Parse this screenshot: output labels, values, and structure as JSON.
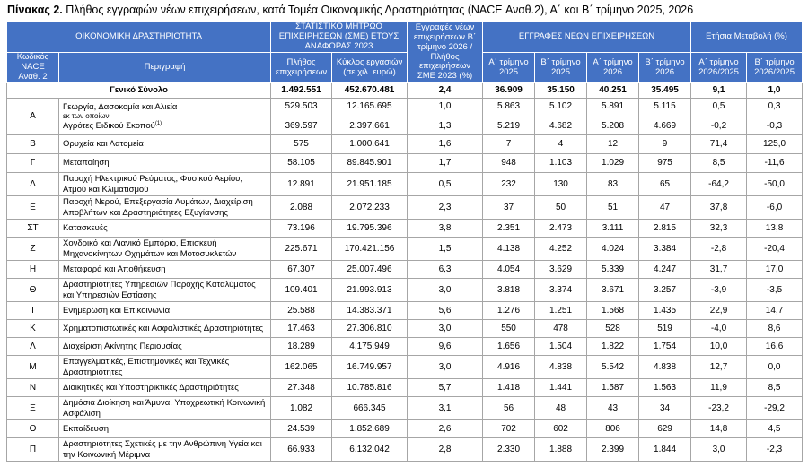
{
  "title_bold": "Πίνακας 2.",
  "title_text": " Πλήθος εγγραφών νέων επιχειρήσεων, κατά Τομέα Οικονομικής Δραστηριότητας (NACE Αναθ.2), Α΄ και Β΄ τρίμηνο 2025, 2026",
  "header": {
    "econ_activity": "ΟΙΚΟΝΟΜΙΚΗ ΔΡΑΣΤΗΡΙΟΤΗΤΑ",
    "sme_register": "ΣΤΑΤΙΣΤΙΚΟ ΜΗΤΡΩΟ ΕΠΙΧΕΙΡΗΣΕΩΝ (ΣΜΕ) ΕΤΟΥΣ ΑΝΑΦΟΡΑΣ 2023",
    "ratio_col": "Εγγραφές νέων επιχειρήσεων Β΄ τρίμηνο 2026 / Πλήθος επιχειρήσεων ΣΜΕ 2023 (%)",
    "new_regs": "ΕΓΓΡΑΦΕΣ ΝΕΩΝ ΕΠΙΧΕΙΡΗΣΕΩΝ",
    "annual_change": "Ετήσια Μεταβολή (%)",
    "code": "Κωδικός NACE Αναθ. 2",
    "description": "Περιγραφή",
    "count": "Πλήθος επιχειρήσεων",
    "turnover": "Κύκλος εργασιών (σε χιλ. ευρώ)",
    "q1_2025": "Α΄ τρίμηνο 2025",
    "q2_2025": "Β΄ τρίμηνο 2025",
    "q1_2026": "Α΄ τρίμηνο 2026",
    "q2_2026": "Β΄ τρίμηνο 2026",
    "ch_q1": "Α΄ τρίμηνο 2026/2025",
    "ch_q2": "Β΄ τρίμηνο 2026/2025"
  },
  "total": {
    "label": "Γενικό Σύνολο",
    "count": "1.492.551",
    "turnover": "452.670.481",
    "ratio": "2,4",
    "q1_2025": "36.909",
    "q2_2025": "35.150",
    "q1_2026": "40.251",
    "q2_2026": "35.495",
    "ch_q1": "9,1",
    "ch_q2": "1,0"
  },
  "section_a": {
    "code": "Α",
    "line1": "Γεωργία, Δασοκομία και Αλιεία",
    "sub": "εκ των οποίων",
    "line2": "Αγρότες Ειδικού Σκοπού",
    "note": "(1)",
    "r1": {
      "count": "529.503",
      "turnover": "12.165.695",
      "ratio": "1,0",
      "q1_2025": "5.863",
      "q2_2025": "5.102",
      "q1_2026": "5.891",
      "q2_2026": "5.115",
      "ch_q1": "0,5",
      "ch_q2": "0,3"
    },
    "r2": {
      "count": "369.597",
      "turnover": "2.397.661",
      "ratio": "1,3",
      "q1_2025": "5.219",
      "q2_2025": "4.682",
      "q1_2026": "5.208",
      "q2_2026": "4.669",
      "ch_q1": "-0,2",
      "ch_q2": "-0,3"
    }
  },
  "rows": [
    {
      "code": "Β",
      "desc": "Ορυχεία και Λατομεία",
      "count": "575",
      "turnover": "1.000.641",
      "ratio": "1,6",
      "q1_2025": "7",
      "q2_2025": "4",
      "q1_2026": "12",
      "q2_2026": "9",
      "ch_q1": "71,4",
      "ch_q2": "125,0"
    },
    {
      "code": "Γ",
      "desc": "Μεταποίηση",
      "count": "58.105",
      "turnover": "89.845.901",
      "ratio": "1,7",
      "q1_2025": "948",
      "q2_2025": "1.103",
      "q1_2026": "1.029",
      "q2_2026": "975",
      "ch_q1": "8,5",
      "ch_q2": "-11,6"
    },
    {
      "code": "Δ",
      "desc": "Παροχή Ηλεκτρικού Ρεύματος, Φυσικού Αερίου, Ατμού και Κλιματισμού",
      "count": "12.891",
      "turnover": "21.951.185",
      "ratio": "0,5",
      "q1_2025": "232",
      "q2_2025": "130",
      "q1_2026": "83",
      "q2_2026": "65",
      "ch_q1": "-64,2",
      "ch_q2": "-50,0"
    },
    {
      "code": "Ε",
      "desc": "Παροχή Νερού, Επεξεργασία Λυμάτων, Διαχείριση Αποβλήτων και Δραστηριότητες Εξυγίανσης",
      "count": "2.088",
      "turnover": "2.072.233",
      "ratio": "2,3",
      "q1_2025": "37",
      "q2_2025": "50",
      "q1_2026": "51",
      "q2_2026": "47",
      "ch_q1": "37,8",
      "ch_q2": "-6,0"
    },
    {
      "code": "ΣΤ",
      "desc": "Κατασκευές",
      "count": "73.196",
      "turnover": "19.795.396",
      "ratio": "3,8",
      "q1_2025": "2.351",
      "q2_2025": "2.473",
      "q1_2026": "3.111",
      "q2_2026": "2.815",
      "ch_q1": "32,3",
      "ch_q2": "13,8"
    },
    {
      "code": "Ζ",
      "desc": "Χονδρικό και Λιανικό Εμπόριο, Επισκευή Μηχανοκίνητων Οχημάτων και Μοτοσυκλετών",
      "count": "225.671",
      "turnover": "170.421.156",
      "ratio": "1,5",
      "q1_2025": "4.138",
      "q2_2025": "4.252",
      "q1_2026": "4.024",
      "q2_2026": "3.384",
      "ch_q1": "-2,8",
      "ch_q2": "-20,4"
    },
    {
      "code": "Η",
      "desc": "Μεταφορά και Αποθήκευση",
      "count": "67.307",
      "turnover": "25.007.496",
      "ratio": "6,3",
      "q1_2025": "4.054",
      "q2_2025": "3.629",
      "q1_2026": "5.339",
      "q2_2026": "4.247",
      "ch_q1": "31,7",
      "ch_q2": "17,0"
    },
    {
      "code": "Θ",
      "desc": "Δραστηριότητες Υπηρεσιών Παροχής Καταλύματος και Υπηρεσιών Εστίασης",
      "count": "109.401",
      "turnover": "21.993.913",
      "ratio": "3,0",
      "q1_2025": "3.818",
      "q2_2025": "3.374",
      "q1_2026": "3.671",
      "q2_2026": "3.257",
      "ch_q1": "-3,9",
      "ch_q2": "-3,5"
    },
    {
      "code": "Ι",
      "desc": "Ενημέρωση και Επικοινωνία",
      "count": "25.588",
      "turnover": "14.383.371",
      "ratio": "5,6",
      "q1_2025": "1.276",
      "q2_2025": "1.251",
      "q1_2026": "1.568",
      "q2_2026": "1.435",
      "ch_q1": "22,9",
      "ch_q2": "14,7"
    },
    {
      "code": "Κ",
      "desc": "Χρηματοπιστωτικές και Ασφαλιστικές Δραστηριότητες",
      "count": "17.463",
      "turnover": "27.306.810",
      "ratio": "3,0",
      "q1_2025": "550",
      "q2_2025": "478",
      "q1_2026": "528",
      "q2_2026": "519",
      "ch_q1": "-4,0",
      "ch_q2": "8,6"
    },
    {
      "code": "Λ",
      "desc": "Διαχείριση Ακίνητης Περιουσίας",
      "count": "18.289",
      "turnover": "4.175.949",
      "ratio": "9,6",
      "q1_2025": "1.656",
      "q2_2025": "1.504",
      "q1_2026": "1.822",
      "q2_2026": "1.754",
      "ch_q1": "10,0",
      "ch_q2": "16,6"
    },
    {
      "code": "Μ",
      "desc": "Επαγγελματικές, Επιστημονικές και Τεχνικές Δραστηριότητες",
      "count": "162.065",
      "turnover": "16.749.957",
      "ratio": "3,0",
      "q1_2025": "4.916",
      "q2_2025": "4.838",
      "q1_2026": "5.542",
      "q2_2026": "4.838",
      "ch_q1": "12,7",
      "ch_q2": "0,0"
    },
    {
      "code": "Ν",
      "desc": "Διοικητικές και Υποστηρικτικές Δραστηριότητες",
      "count": "27.348",
      "turnover": "10.785.816",
      "ratio": "5,7",
      "q1_2025": "1.418",
      "q2_2025": "1.441",
      "q1_2026": "1.587",
      "q2_2026": "1.563",
      "ch_q1": "11,9",
      "ch_q2": "8,5"
    },
    {
      "code": "Ξ",
      "desc": "Δημόσια Διοίκηση και Άμυνα, Υποχρεωτική Κοινωνική Ασφάλιση",
      "count": "1.082",
      "turnover": "666.345",
      "ratio": "3,1",
      "q1_2025": "56",
      "q2_2025": "48",
      "q1_2026": "43",
      "q2_2026": "34",
      "ch_q1": "-23,2",
      "ch_q2": "-29,2"
    },
    {
      "code": "Ο",
      "desc": "Εκπαίδευση",
      "count": "24.539",
      "turnover": "1.852.689",
      "ratio": "2,6",
      "q1_2025": "702",
      "q2_2025": "602",
      "q1_2026": "806",
      "q2_2026": "629",
      "ch_q1": "14,8",
      "ch_q2": "4,5"
    },
    {
      "code": "Π",
      "desc": "Δραστηριότητες Σχετικές με την Ανθρώπινη Υγεία και την Κοινωνική Μέριμνα",
      "count": "66.933",
      "turnover": "6.132.042",
      "ratio": "2,8",
      "q1_2025": "2.330",
      "q2_2025": "1.888",
      "q1_2026": "2.399",
      "q2_2026": "1.844",
      "ch_q1": "3,0",
      "ch_q2": "-2,3"
    }
  ]
}
